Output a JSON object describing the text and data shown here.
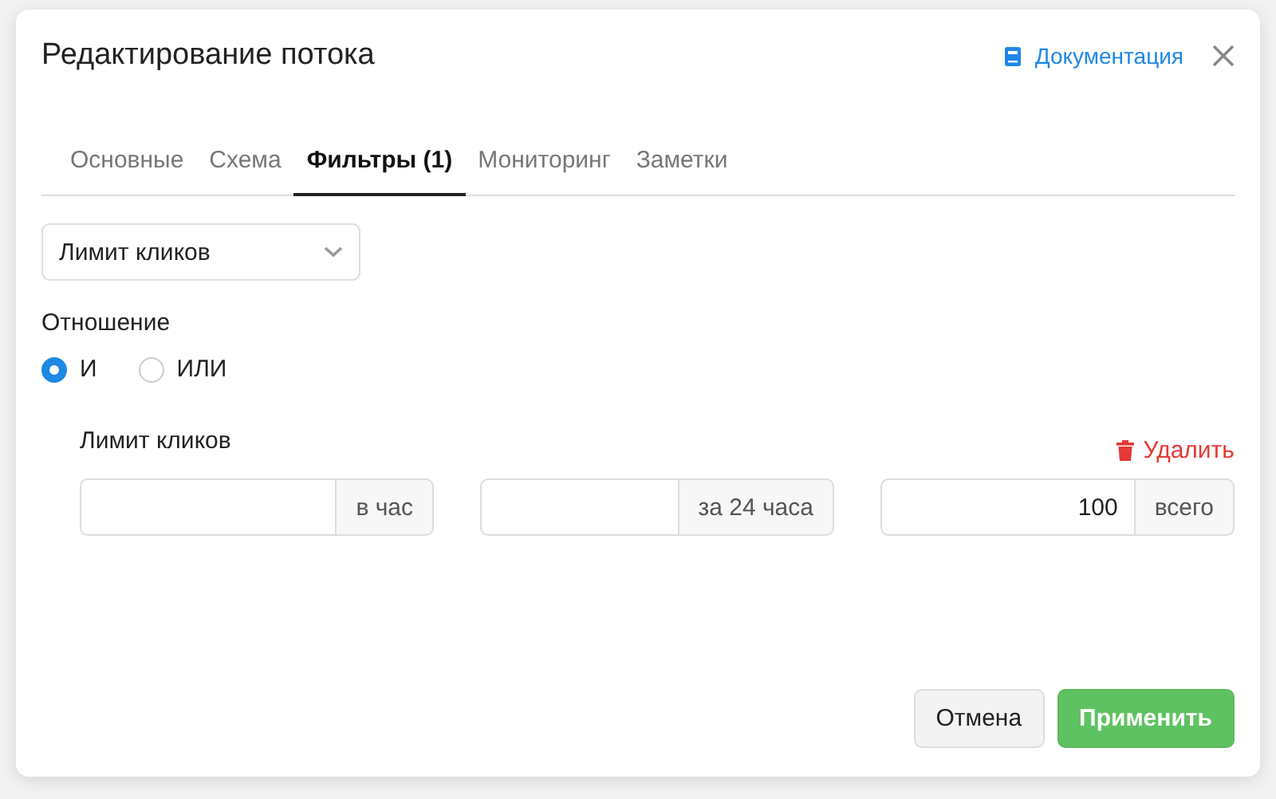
{
  "dialog": {
    "title": "Редактирование потока",
    "docs_link": "Документация"
  },
  "tabs": [
    {
      "label": "Основные",
      "selected": false
    },
    {
      "label": "Схема",
      "selected": false
    },
    {
      "label": "Фильтры (1)",
      "selected": true
    },
    {
      "label": "Мониторинг",
      "selected": false
    },
    {
      "label": "Заметки",
      "selected": false
    }
  ],
  "filter_select": {
    "value": "Лимит кликов"
  },
  "relation": {
    "label": "Отношение",
    "options": [
      {
        "label": "И",
        "selected": true
      },
      {
        "label": "ИЛИ",
        "selected": false
      }
    ]
  },
  "filter": {
    "title": "Лимит кликов",
    "delete_label": "Удалить",
    "fields": [
      {
        "suffix": "в час"
      },
      {
        "suffix": "за 24 часа"
      },
      {
        "value": "100",
        "suffix": "всего"
      }
    ]
  },
  "buttons": {
    "cancel": "Отмена",
    "apply": "Применить"
  }
}
